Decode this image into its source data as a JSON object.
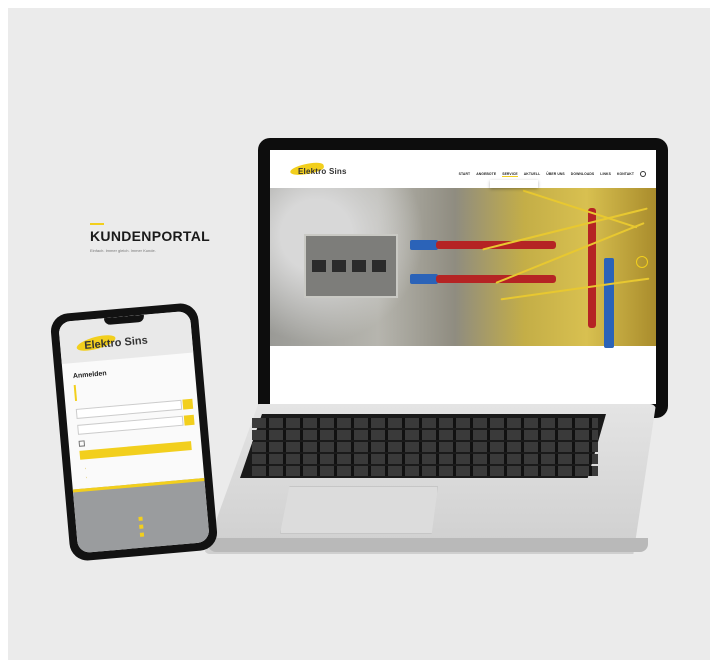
{
  "laptop": {
    "logo": "Elektro Sins",
    "nav": [
      "START",
      "ANGEBOTE",
      "SERVICE",
      "AKTUELL",
      "ÜBER UNS",
      "DOWNLOADS",
      "LINKS",
      "KONTAKT"
    ],
    "headline": "KUNDENPORTAL",
    "subline": "Einfach. Immer gleich. Immer Kunde."
  },
  "phone": {
    "logo": "Elektro Sins",
    "title": "Anmelden"
  },
  "colors": {
    "accent": "#f2cf1d",
    "background": "#ebebeb",
    "device": "#121212"
  }
}
